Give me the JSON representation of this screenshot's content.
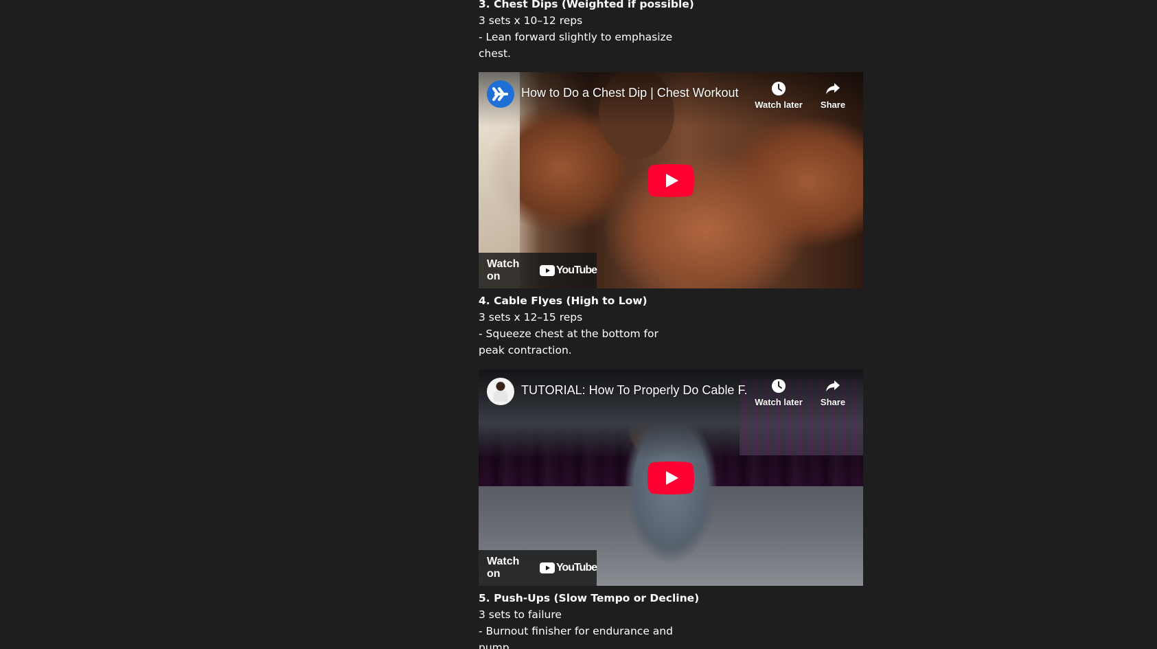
{
  "sections": [
    {
      "heading": "3. Chest Dips (Weighted if possible)",
      "sets": "3 sets x 10–12 reps",
      "note": "- Lean forward slightly to emphasize chest."
    },
    {
      "heading": "4. Cable Flyes (High to Low)",
      "sets": "3 sets x 12–15 reps",
      "note": "- Squeeze chest at the bottom for peak contraction."
    },
    {
      "heading": "5. Push-Ups (Slow Tempo or Decline)",
      "sets": "3 sets to failure",
      "note": "- Burnout finisher for endurance and pump."
    }
  ],
  "videos": [
    {
      "title": "How to Do a Chest Dip | Chest Workout",
      "watch_later": "Watch later",
      "share": "Share",
      "watch_on": "Watch on",
      "youtube": "YouTube",
      "avatar_icon": "channel-logo-icon"
    },
    {
      "title": "TUTORIAL: How To Properly Do Cable F...",
      "watch_later": "Watch later",
      "share": "Share",
      "watch_on": "Watch on",
      "youtube": "YouTube",
      "avatar_icon": "channel-avatar-icon"
    }
  ],
  "colors": {
    "background": "#1e1e1e",
    "text": "#ffffff",
    "youtube_red": "#ff0033"
  }
}
